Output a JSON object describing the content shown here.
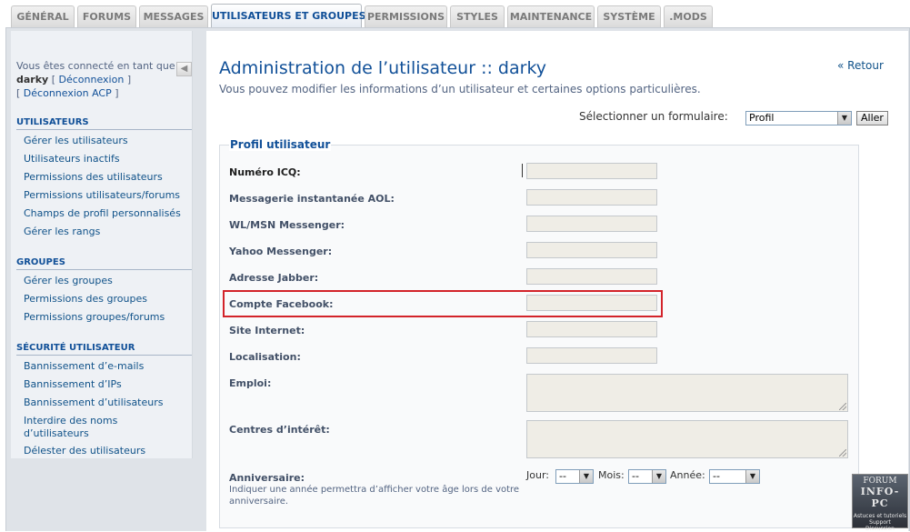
{
  "tabs": [
    {
      "label": "GÉNÉRAL"
    },
    {
      "label": "FORUMS"
    },
    {
      "label": "MESSAGES"
    },
    {
      "label": "UTILISATEURS ET GROUPES"
    },
    {
      "label": "PERMISSIONS"
    },
    {
      "label": "STYLES"
    },
    {
      "label": "MAINTENANCE"
    },
    {
      "label": "SYSTÈME"
    },
    {
      "label": ".MODS"
    }
  ],
  "sidebar": {
    "logged_in_text": "Vous êtes connecté en tant que",
    "username": "darky",
    "logout_label": "Déconnexion",
    "acp_logout_label": "Déconnexion ACP",
    "bracket_open": "[",
    "bracket_close": "]",
    "collapse_glyph": "◀",
    "sections": [
      {
        "title": "UTILISATEURS",
        "items": [
          {
            "label": "Gérer les utilisateurs"
          },
          {
            "label": "Utilisateurs inactifs"
          },
          {
            "label": "Permissions des utilisateurs"
          },
          {
            "label": "Permissions utilisateurs/forums"
          },
          {
            "label": "Champs de profil personnalisés"
          },
          {
            "label": "Gérer les rangs"
          }
        ]
      },
      {
        "title": "GROUPES",
        "items": [
          {
            "label": "Gérer les groupes"
          },
          {
            "label": "Permissions des groupes"
          },
          {
            "label": "Permissions groupes/forums"
          }
        ]
      },
      {
        "title": "SÉCURITÉ UTILISATEUR",
        "items": [
          {
            "label": "Bannissement d’e-mails"
          },
          {
            "label": "Bannissement d’IPs"
          },
          {
            "label": "Bannissement d’utilisateurs"
          },
          {
            "label": "Interdire des noms",
            "label2": "d’utilisateurs"
          },
          {
            "label": "Délester des utilisateurs"
          }
        ]
      }
    ]
  },
  "main": {
    "title": "Administration de l’utilisateur :: darky",
    "description": "Vous pouvez modifier les informations d’un utilisateur et certaines options particulières.",
    "back_link": "« Retour",
    "form_selector": {
      "label": "Sélectionner un formulaire:",
      "value": "Profil",
      "button": "Aller"
    },
    "fieldset_legend": "Profil utilisateur",
    "fields": [
      {
        "label": "Numéro ICQ:",
        "value": ""
      },
      {
        "label": "Messagerie instantanée AOL:",
        "value": ""
      },
      {
        "label": "WL/MSN Messenger:",
        "value": ""
      },
      {
        "label": "Yahoo Messenger:",
        "value": ""
      },
      {
        "label": "Adresse Jabber:",
        "value": ""
      },
      {
        "label": "Compte Facebook:",
        "value": ""
      },
      {
        "label": "Site Internet:",
        "value": ""
      },
      {
        "label": "Localisation:",
        "value": ""
      },
      {
        "label": "Emploi:",
        "value": ""
      },
      {
        "label": "Centres d’intérêt:",
        "value": ""
      }
    ],
    "birthday": {
      "label": "Anniversaire:",
      "description": "Indiquer une année permettra d’afficher votre âge lors de votre anniversaire.",
      "day_label": "Jour:",
      "day_value": "--",
      "month_label": "Mois:",
      "month_value": "--",
      "year_label": "Année:",
      "year_value": "--"
    }
  },
  "watermark": {
    "line1": "FORUM",
    "line2": "INFO-PC",
    "line3": "Astuces et tutoriels",
    "line4": "Support",
    "line5": "Discussion"
  },
  "colors": {
    "accent": "#115098",
    "highlight": "#d3232a"
  }
}
